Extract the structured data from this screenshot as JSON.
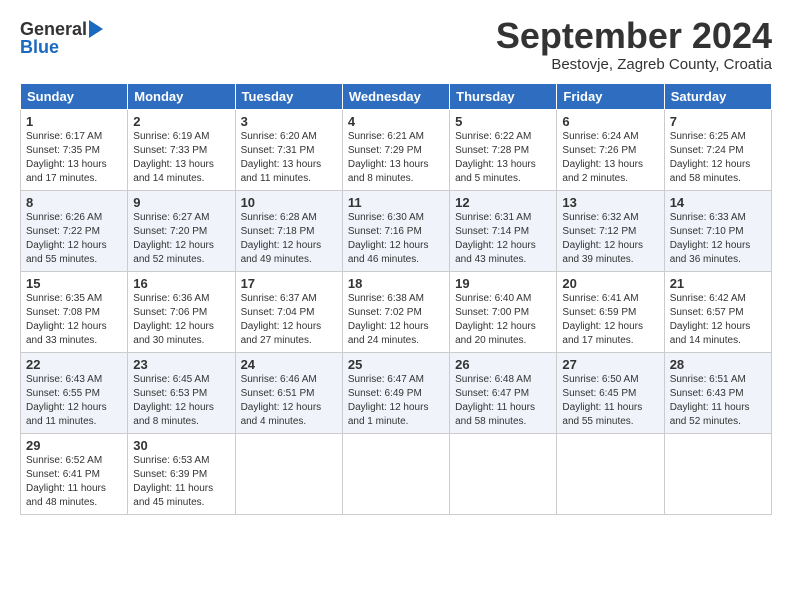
{
  "logo": {
    "general": "General",
    "blue": "Blue"
  },
  "title": {
    "month": "September 2024",
    "location": "Bestovje, Zagreb County, Croatia"
  },
  "headers": [
    "Sunday",
    "Monday",
    "Tuesday",
    "Wednesday",
    "Thursday",
    "Friday",
    "Saturday"
  ],
  "weeks": [
    [
      {
        "day": "1",
        "info": "Sunrise: 6:17 AM\nSunset: 7:35 PM\nDaylight: 13 hours\nand 17 minutes."
      },
      {
        "day": "2",
        "info": "Sunrise: 6:19 AM\nSunset: 7:33 PM\nDaylight: 13 hours\nand 14 minutes."
      },
      {
        "day": "3",
        "info": "Sunrise: 6:20 AM\nSunset: 7:31 PM\nDaylight: 13 hours\nand 11 minutes."
      },
      {
        "day": "4",
        "info": "Sunrise: 6:21 AM\nSunset: 7:29 PM\nDaylight: 13 hours\nand 8 minutes."
      },
      {
        "day": "5",
        "info": "Sunrise: 6:22 AM\nSunset: 7:28 PM\nDaylight: 13 hours\nand 5 minutes."
      },
      {
        "day": "6",
        "info": "Sunrise: 6:24 AM\nSunset: 7:26 PM\nDaylight: 13 hours\nand 2 minutes."
      },
      {
        "day": "7",
        "info": "Sunrise: 6:25 AM\nSunset: 7:24 PM\nDaylight: 12 hours\nand 58 minutes."
      }
    ],
    [
      {
        "day": "8",
        "info": "Sunrise: 6:26 AM\nSunset: 7:22 PM\nDaylight: 12 hours\nand 55 minutes."
      },
      {
        "day": "9",
        "info": "Sunrise: 6:27 AM\nSunset: 7:20 PM\nDaylight: 12 hours\nand 52 minutes."
      },
      {
        "day": "10",
        "info": "Sunrise: 6:28 AM\nSunset: 7:18 PM\nDaylight: 12 hours\nand 49 minutes."
      },
      {
        "day": "11",
        "info": "Sunrise: 6:30 AM\nSunset: 7:16 PM\nDaylight: 12 hours\nand 46 minutes."
      },
      {
        "day": "12",
        "info": "Sunrise: 6:31 AM\nSunset: 7:14 PM\nDaylight: 12 hours\nand 43 minutes."
      },
      {
        "day": "13",
        "info": "Sunrise: 6:32 AM\nSunset: 7:12 PM\nDaylight: 12 hours\nand 39 minutes."
      },
      {
        "day": "14",
        "info": "Sunrise: 6:33 AM\nSunset: 7:10 PM\nDaylight: 12 hours\nand 36 minutes."
      }
    ],
    [
      {
        "day": "15",
        "info": "Sunrise: 6:35 AM\nSunset: 7:08 PM\nDaylight: 12 hours\nand 33 minutes."
      },
      {
        "day": "16",
        "info": "Sunrise: 6:36 AM\nSunset: 7:06 PM\nDaylight: 12 hours\nand 30 minutes."
      },
      {
        "day": "17",
        "info": "Sunrise: 6:37 AM\nSunset: 7:04 PM\nDaylight: 12 hours\nand 27 minutes."
      },
      {
        "day": "18",
        "info": "Sunrise: 6:38 AM\nSunset: 7:02 PM\nDaylight: 12 hours\nand 24 minutes."
      },
      {
        "day": "19",
        "info": "Sunrise: 6:40 AM\nSunset: 7:00 PM\nDaylight: 12 hours\nand 20 minutes."
      },
      {
        "day": "20",
        "info": "Sunrise: 6:41 AM\nSunset: 6:59 PM\nDaylight: 12 hours\nand 17 minutes."
      },
      {
        "day": "21",
        "info": "Sunrise: 6:42 AM\nSunset: 6:57 PM\nDaylight: 12 hours\nand 14 minutes."
      }
    ],
    [
      {
        "day": "22",
        "info": "Sunrise: 6:43 AM\nSunset: 6:55 PM\nDaylight: 12 hours\nand 11 minutes."
      },
      {
        "day": "23",
        "info": "Sunrise: 6:45 AM\nSunset: 6:53 PM\nDaylight: 12 hours\nand 8 minutes."
      },
      {
        "day": "24",
        "info": "Sunrise: 6:46 AM\nSunset: 6:51 PM\nDaylight: 12 hours\nand 4 minutes."
      },
      {
        "day": "25",
        "info": "Sunrise: 6:47 AM\nSunset: 6:49 PM\nDaylight: 12 hours\nand 1 minute."
      },
      {
        "day": "26",
        "info": "Sunrise: 6:48 AM\nSunset: 6:47 PM\nDaylight: 11 hours\nand 58 minutes."
      },
      {
        "day": "27",
        "info": "Sunrise: 6:50 AM\nSunset: 6:45 PM\nDaylight: 11 hours\nand 55 minutes."
      },
      {
        "day": "28",
        "info": "Sunrise: 6:51 AM\nSunset: 6:43 PM\nDaylight: 11 hours\nand 52 minutes."
      }
    ],
    [
      {
        "day": "29",
        "info": "Sunrise: 6:52 AM\nSunset: 6:41 PM\nDaylight: 11 hours\nand 48 minutes."
      },
      {
        "day": "30",
        "info": "Sunrise: 6:53 AM\nSunset: 6:39 PM\nDaylight: 11 hours\nand 45 minutes."
      },
      {
        "day": "",
        "info": ""
      },
      {
        "day": "",
        "info": ""
      },
      {
        "day": "",
        "info": ""
      },
      {
        "day": "",
        "info": ""
      },
      {
        "day": "",
        "info": ""
      }
    ]
  ]
}
